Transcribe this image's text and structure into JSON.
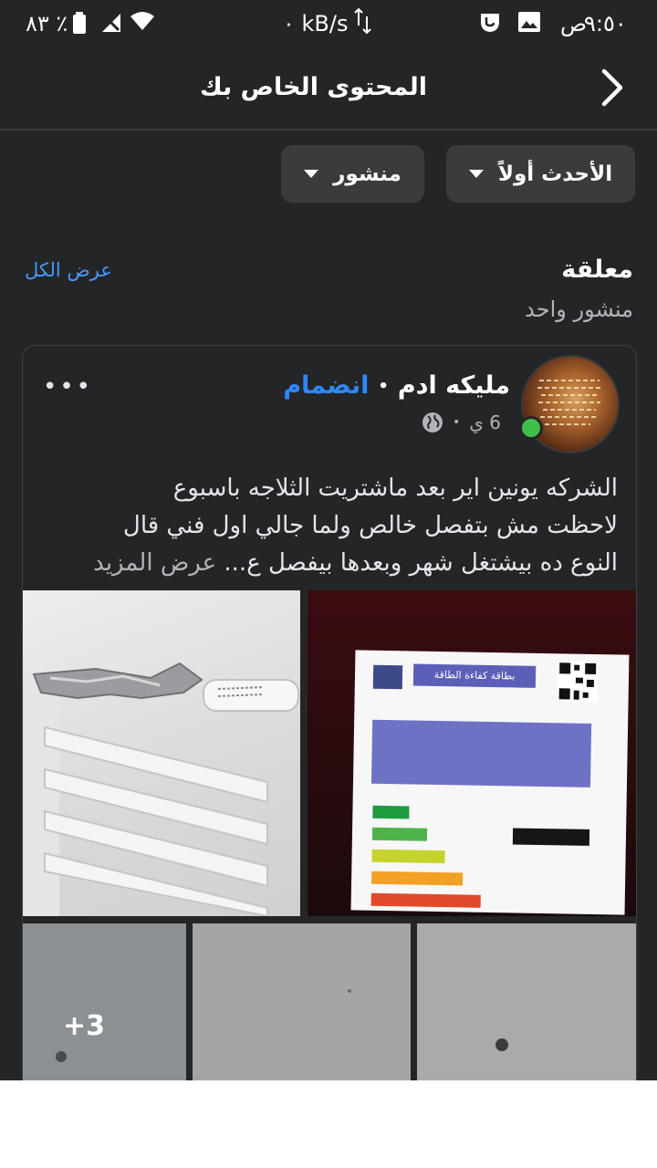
{
  "status_bar": {
    "time": "٩:٥٠",
    "ampm": "ص",
    "network_speed": "٠ kB/s",
    "battery": "٨٣ ٪"
  },
  "header": {
    "title": "المحتوى الخاص بك"
  },
  "filters": [
    {
      "label": "الأحدث أولاً"
    },
    {
      "label": "منشور"
    }
  ],
  "pinned": {
    "title": "معلقة",
    "subtitle": "منشور واحد",
    "see_all": "عرض الكل"
  },
  "post": {
    "author": "مليكه ادم",
    "join_label": "انضمام",
    "time_ago": "6 ي",
    "text_line1": "الشركه يونين اير  بعد ماشتريت الثلاجه باسبوع",
    "text_line2": "لاحظت مش بتفصل خالص ولما جالي اول فني قال",
    "text_line3": "النوع ده بيشتغل شهر وبعدها بيفصل ع...",
    "see_more": "عرض المزيد",
    "more_photos": "+3",
    "label_heading": "بطاقة كفاءة الطاقة"
  }
}
